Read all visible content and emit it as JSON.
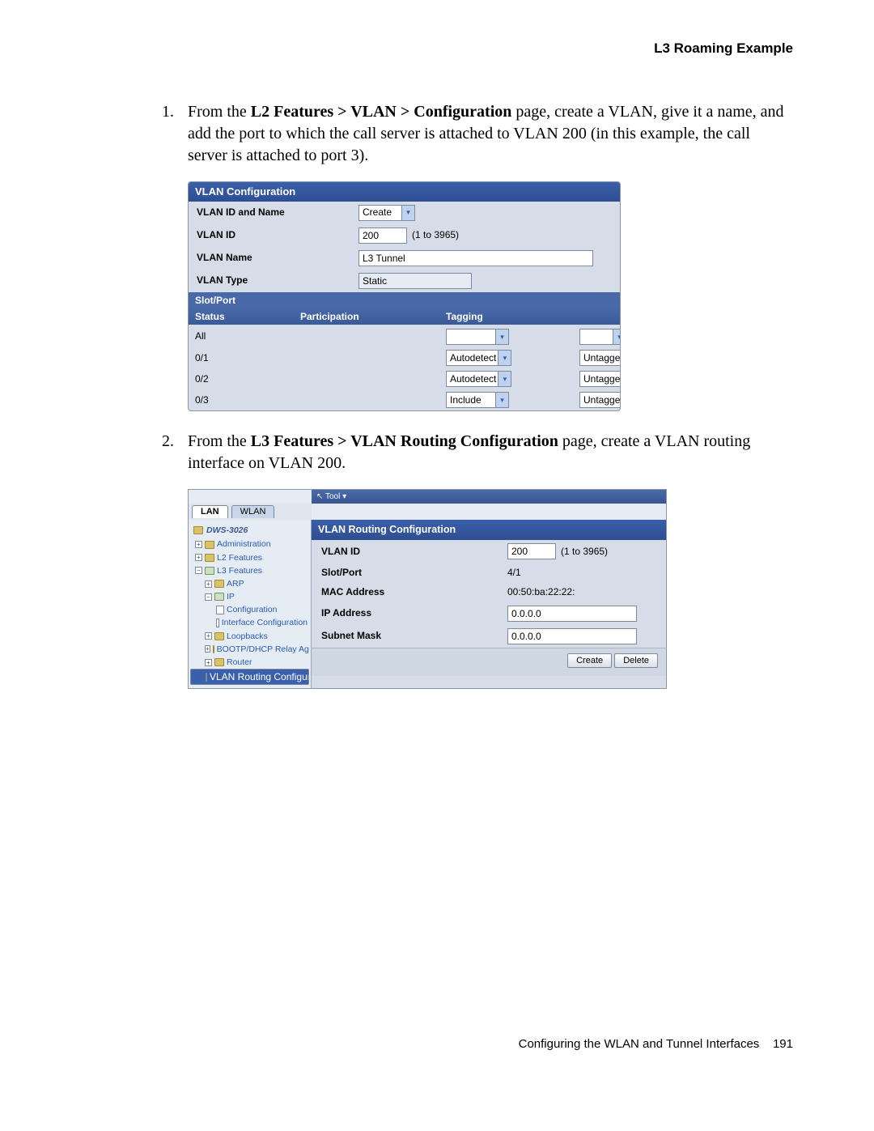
{
  "header": "L3 Roaming Example",
  "steps": {
    "s1_a": "From the ",
    "s1_b": "L2 Features > VLAN > Configuration",
    "s1_c": " page, create a VLAN, give it a name, and add the port to which the call server is attached to VLAN 200 (in this example, the call server is attached to port 3).",
    "s2_a": "From the ",
    "s2_b": "L3 Features > VLAN Routing Configuration",
    "s2_c": " page, create a VLAN routing interface on VLAN 200."
  },
  "shot1": {
    "title": "VLAN Configuration",
    "r1": {
      "lbl": "VLAN ID and Name",
      "val": "Create"
    },
    "r2": {
      "lbl": "VLAN ID",
      "val": "200",
      "hint": "(1 to 3965)"
    },
    "r3": {
      "lbl": "VLAN Name",
      "val": "L3 Tunnel"
    },
    "r4": {
      "lbl": "VLAN Type",
      "val": "Static"
    },
    "sp": "Slot/Port",
    "col1": "Status",
    "col2": "Participation",
    "col3": "Tagging",
    "rows": [
      {
        "p": "All",
        "part": "",
        "tag": ""
      },
      {
        "p": "0/1",
        "part": "Autodetect",
        "tag": "Untagged"
      },
      {
        "p": "0/2",
        "part": "Autodetect",
        "tag": "Untagged"
      },
      {
        "p": "0/3",
        "part": "Include",
        "tag": "Untagged"
      }
    ]
  },
  "shot2": {
    "tool": "Tool ▾",
    "tabs": {
      "lan": "LAN",
      "wlan": "WLAN"
    },
    "device": "DWS-3026",
    "nav": {
      "admin": "Administration",
      "l2": "L2 Features",
      "l3": "L3 Features",
      "arp": "ARP",
      "ip": "IP",
      "conf": "Configuration",
      "iface": "Interface Configuration",
      "loop": "Loopbacks",
      "bootp": "BOOTP/DHCP Relay Agent",
      "router": "Router",
      "vlanr": "VLAN Routing Configurati"
    },
    "title": "VLAN Routing Configuration",
    "fields": {
      "vlanid": {
        "lbl": "VLAN ID",
        "val": "200",
        "hint": "(1 to 3965)"
      },
      "slot": {
        "lbl": "Slot/Port",
        "val": "4/1"
      },
      "mac": {
        "lbl": "MAC Address",
        "val": "00:50:ba:22:22:"
      },
      "ip": {
        "lbl": "IP Address",
        "val": "0.0.0.0"
      },
      "mask": {
        "lbl": "Subnet Mask",
        "val": "0.0.0.0"
      }
    },
    "btn_create": "Create",
    "btn_delete": "Delete"
  },
  "footer": {
    "text": "Configuring the WLAN and Tunnel Interfaces",
    "page": "191"
  }
}
